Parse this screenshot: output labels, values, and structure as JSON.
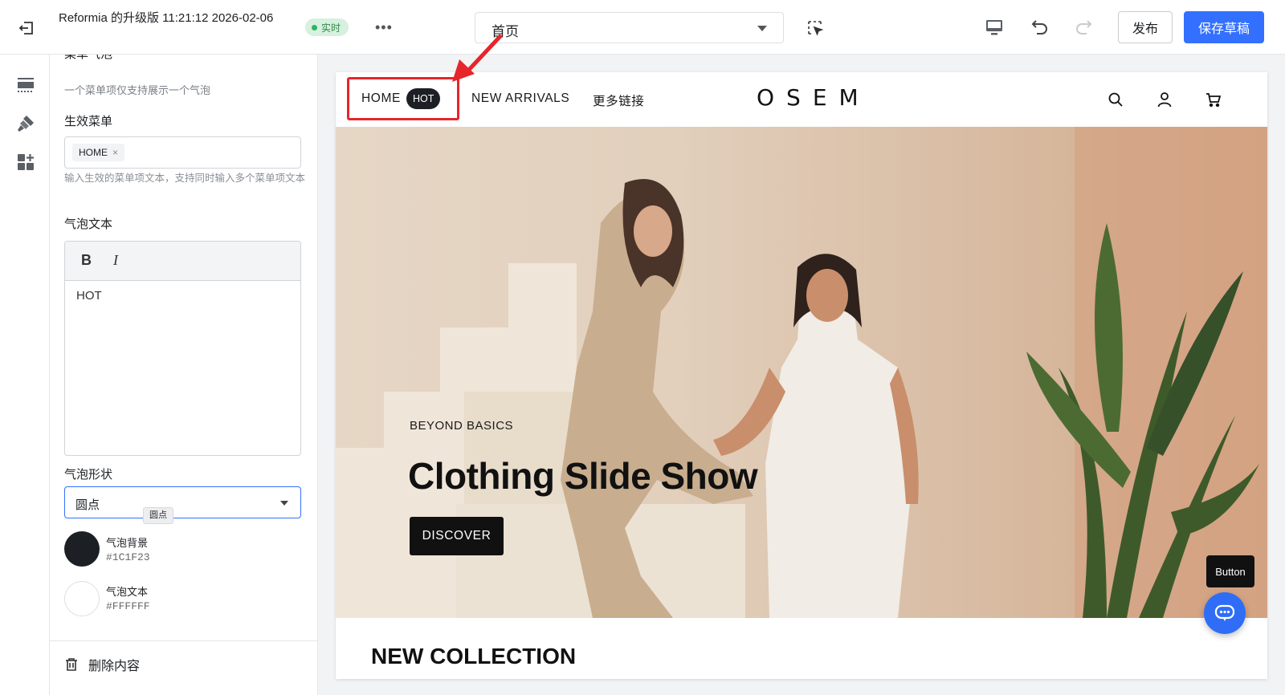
{
  "topbar": {
    "title": "Reformia 的升级版 11:21:12 2026-02-06",
    "live_label": "实时",
    "more_label": "•••",
    "page_select_value": "首页",
    "publish_label": "发布",
    "save_label": "保存草稿"
  },
  "panel": {
    "section_heading": "菜单气泡",
    "section_desc": "一个菜单项仅支持展示一个气泡",
    "active_menu_label": "生效菜单",
    "active_menu_tag": "HOME",
    "active_menu_hint": "输入生效的菜单项文本，支持同时输入多个菜单项文本",
    "bubble_text_label": "气泡文本",
    "bold_label": "B",
    "italic_label": "I",
    "bubble_text_value": "HOT",
    "bubble_shape_label": "气泡形状",
    "bubble_shape_value": "圆点",
    "bubble_shape_tooltip": "圆点",
    "bg_color_label": "气泡背景",
    "bg_color": "#1C1F23",
    "text_color_label": "气泡文本",
    "text_color": "#FFFFFF",
    "delete_label": "删除内容"
  },
  "preview": {
    "nav": {
      "home": "HOME",
      "hot_badge": "HOT",
      "new_arrivals": "NEW ARRIVALS",
      "more_links": "更多链接",
      "logo": "OSEM"
    },
    "hero": {
      "eyebrow": "BEYOND BASICS",
      "title": "Clothing Slide Show",
      "button": "DISCOVER"
    },
    "section_title": "NEW COLLECTION",
    "button_tooltip": "Button"
  },
  "colors": {
    "accent": "#3370FF",
    "annotation": "#E5262B",
    "live_green": "#2DB55D"
  }
}
